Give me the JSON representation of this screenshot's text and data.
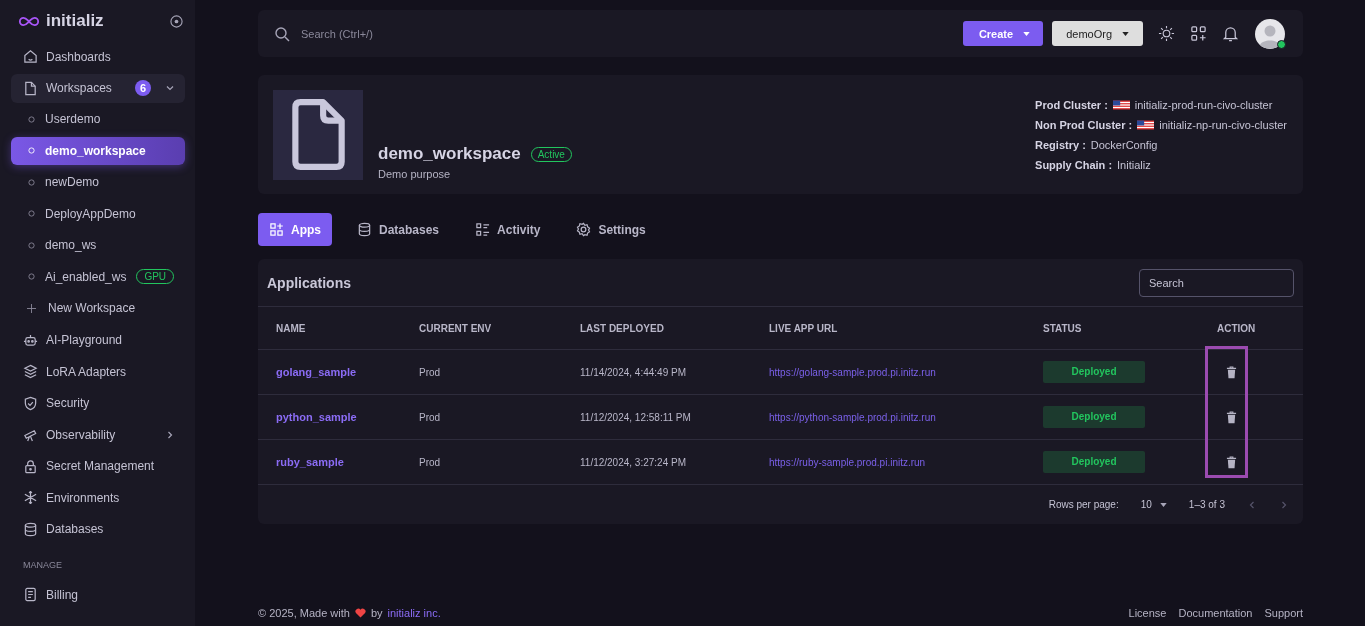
{
  "sidebar": {
    "logo": "initializ",
    "sections": [
      {
        "items": [
          {
            "label": "Dashboards"
          },
          {
            "label": "Workspaces",
            "badge": "6",
            "expanded": true,
            "children": [
              {
                "label": "Userdemo",
                "selected": false
              },
              {
                "label": "demo_workspace",
                "selected": true
              },
              {
                "label": "newDemo",
                "selected": false
              },
              {
                "label": "DeployAppDemo",
                "selected": false
              },
              {
                "label": "demo_ws",
                "selected": false
              },
              {
                "label": "Ai_enabled_ws",
                "selected": false,
                "tag": "GPU"
              }
            ],
            "add": "New Workspace"
          },
          {
            "label": "AI-Playground"
          },
          {
            "label": "LoRA Adapters"
          },
          {
            "label": "Security"
          },
          {
            "label": "Observability",
            "expanded": false
          },
          {
            "label": "Secret Management"
          },
          {
            "label": "Environments"
          },
          {
            "label": "Databases"
          }
        ]
      },
      {
        "title": "MANAGE",
        "items": [
          {
            "label": "Billing"
          }
        ]
      }
    ]
  },
  "header": {
    "search": {
      "placeholder": "Search (Ctrl+/)"
    },
    "create": "Create",
    "org": "demoOrg",
    "online": true
  },
  "workspace": {
    "name": "demo_workspace",
    "status": "Active",
    "description": "Demo purpose",
    "details": [
      {
        "label": "Prod Cluster :",
        "value": "initializ-prod-run-civo-cluster",
        "flag": true
      },
      {
        "label": "Non Prod Cluster :",
        "value": "initializ-np-run-civo-cluster",
        "flag": true
      },
      {
        "label": "Registry :",
        "value": "DockerConfig",
        "flag": false
      },
      {
        "label": "Supply Chain :",
        "value": "Initializ",
        "flag": false
      }
    ]
  },
  "tabs": [
    {
      "label": "Apps",
      "selected": true
    },
    {
      "label": "Databases",
      "selected": false
    },
    {
      "label": "Activity",
      "selected": false
    },
    {
      "label": "Settings",
      "selected": false
    }
  ],
  "table": {
    "title": "Applications",
    "search": {
      "placeholder": "Search"
    },
    "columns": [
      "NAME",
      "CURRENT ENV",
      "LAST DEPLOYED",
      "LIVE APP URL",
      "STATUS",
      "ACTION"
    ],
    "rows": [
      {
        "name": "golang_sample",
        "env": "Prod",
        "deployed": "11/14/2024, 4:44:49 PM",
        "url": "https://golang-sample.prod.pi.initz.run",
        "status": "Deployed"
      },
      {
        "name": "python_sample",
        "env": "Prod",
        "deployed": "11/12/2024, 12:58:11 PM",
        "url": "https://python-sample.prod.pi.initz.run",
        "status": "Deployed"
      },
      {
        "name": "ruby_sample",
        "env": "Prod",
        "deployed": "11/12/2024, 3:27:24 PM",
        "url": "https://ruby-sample.prod.pi.initz.run",
        "status": "Deployed"
      }
    ],
    "pagination": {
      "rows_label": "Rows per page:",
      "rows_value": "10",
      "range": "1–3 of 3"
    }
  },
  "footer": {
    "text": "© 2025, Made with",
    "by": "by",
    "link": "initializ inc.",
    "links": [
      "License",
      "Documentation",
      "Support"
    ]
  }
}
